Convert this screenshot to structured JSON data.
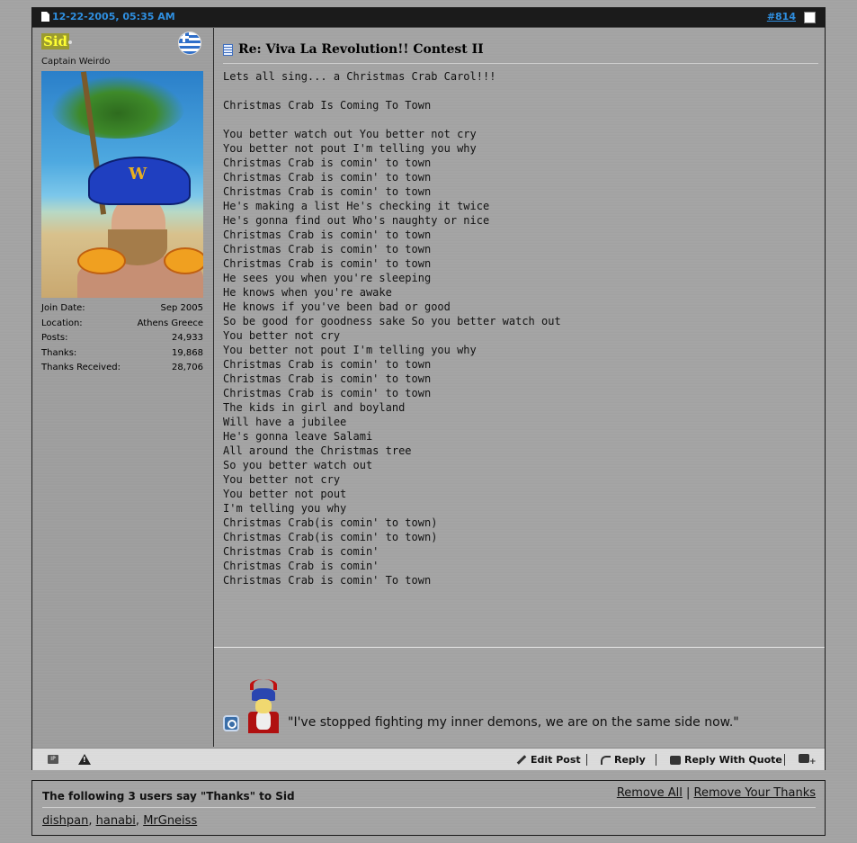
{
  "post": {
    "date": "12-22-2005, 05:35 AM",
    "number": "#814"
  },
  "user": {
    "name": "Sid",
    "title": "Captain Weirdo",
    "stats": [
      {
        "label": "Join Date:",
        "value": "Sep 2005"
      },
      {
        "label": "Location:",
        "value": "Athens Greece"
      },
      {
        "label": "Posts:",
        "value": "24,933"
      },
      {
        "label": "Thanks:",
        "value": "19,868"
      },
      {
        "label": "Thanks Received:",
        "value": "28,706"
      }
    ]
  },
  "message": {
    "title": "Re: Viva La Revolution!! Contest II",
    "body": "Lets all sing... a Christmas Crab Carol!!!\n\nChristmas Crab Is Coming To Town\n\nYou better watch out You better not cry\nYou better not pout I'm telling you why\nChristmas Crab is comin' to town\nChristmas Crab is comin' to town\nChristmas Crab is comin' to town\nHe's making a list He's checking it twice\nHe's gonna find out Who's naughty or nice\nChristmas Crab is comin' to town\nChristmas Crab is comin' to town\nChristmas Crab is comin' to town\nHe sees you when you're sleeping\nHe knows when you're awake\nHe knows if you've been bad or good\nSo be good for goodness sake So you better watch out\nYou better not cry\nYou better not pout I'm telling you why\nChristmas Crab is comin' to town\nChristmas Crab is comin' to town\nChristmas Crab is comin' to town\nThe kids in girl and boyland\nWill have a jubilee\nHe's gonna leave Salami\nAll around the Christmas tree\nSo you better watch out\nYou better not cry\nYou better not pout\nI'm telling you why\nChristmas Crab(is comin' to town)\nChristmas Crab(is comin' to town)\nChristmas Crab is comin'\nChristmas Crab is comin'\nChristmas Crab is comin' To town",
    "signature": "\"I've stopped fighting my inner demons, we are on the same side now.\""
  },
  "footer": {
    "edit": "Edit Post",
    "reply": "Reply",
    "reply_quote": "Reply With Quote"
  },
  "thanks": {
    "heading": "The following 3 users say \"Thanks\" to Sid",
    "remove_all": "Remove All",
    "divider": "|",
    "remove_yours": "Remove Your Thanks",
    "users": [
      "dishpan",
      "hanabi",
      "MrGneiss"
    ],
    "comma": ","
  },
  "icons": {
    "post_icon": "document-icon",
    "flag": "greece-flag-icon",
    "ip": "ip-icon",
    "report": "warning-icon",
    "multiquote": "multi-quote-icon"
  },
  "colors": {
    "accent_link": "#2f8fe0",
    "username": "#ffff33",
    "header_bg": "#1b1b1b"
  }
}
